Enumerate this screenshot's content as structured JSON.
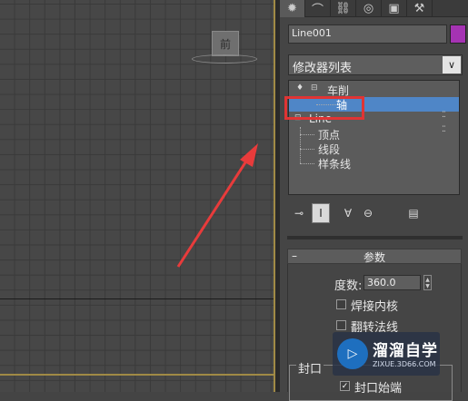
{
  "viewport": {
    "gizmo_label": "前"
  },
  "tabs": [
    {
      "icon": "sun-icon",
      "glyph": "✹",
      "active": true
    },
    {
      "icon": "curve-icon",
      "glyph": "⌒",
      "active": false
    },
    {
      "icon": "hierarchy-icon",
      "glyph": "⛓",
      "active": false
    },
    {
      "icon": "motion-icon",
      "glyph": "◎",
      "active": false
    },
    {
      "icon": "display-icon",
      "glyph": "▣",
      "active": false
    },
    {
      "icon": "hammer-icon",
      "glyph": "⚒",
      "active": false
    }
  ],
  "object": {
    "name": "Line001",
    "color": "#a533b3"
  },
  "modifier_list": {
    "label": "修改器列表",
    "arrow": "∨"
  },
  "stack": {
    "items": [
      {
        "label": "车削",
        "level": 0
      },
      {
        "label": "轴",
        "level": 1,
        "selected": true
      },
      {
        "label": "Line",
        "level": 0
      },
      {
        "label": "顶点",
        "level": 1
      },
      {
        "label": "线段",
        "level": 1
      },
      {
        "label": "样条线",
        "level": 1
      }
    ]
  },
  "parameters": {
    "title": "参数",
    "collapse": "–",
    "degrees_label": "度数:",
    "degrees_value": "360.0",
    "weld_core_label": "焊接内核",
    "flip_normals_label": "翻转法线",
    "capping_group_label": "封口",
    "cap_start_label": "封口始端",
    "cap_start_checked": "✓"
  },
  "watermark": {
    "title": "溜溜自学",
    "subtitle": "ZIXUE.3D66.COM",
    "glyph": "▷"
  }
}
